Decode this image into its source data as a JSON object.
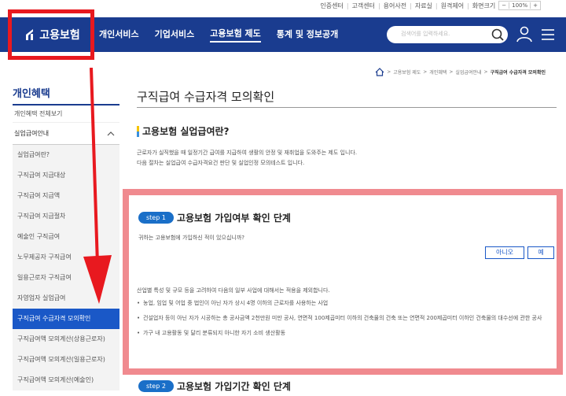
{
  "util": {
    "links": [
      "인증센터",
      "고객센터",
      "용어사전",
      "자료실",
      "원격제어",
      "화면크기"
    ],
    "zoom_out": "−",
    "zoom_value": "100%",
    "zoom_in": "+"
  },
  "header": {
    "logo_text": "고용보험",
    "nav": [
      "개인서비스",
      "기업서비스",
      "고용보험 제도",
      "통계 및 정보공개"
    ],
    "active_nav": "고용보험 제도",
    "search_placeholder": "검색어를 입력하세요."
  },
  "breadcrumb": [
    "고용보험 제도",
    "개인혜택",
    "실업급여안내",
    "구직급여 수급자격 모의확인"
  ],
  "sidebar": {
    "title": "개인혜택",
    "all_link": "개인혜택 전체보기",
    "group": "실업급여안내",
    "items": [
      "실업급여란?",
      "구직급여 지급대상",
      "구직급여 지급액",
      "구직급여 지급절차",
      "예술인 구직급여",
      "노무제공자 구직급여",
      "일용근로자 구직급여",
      "자영업자 실업급여",
      "구직급여 수급자격 모의확인",
      "구직급여액 모의계산(상용근로자)",
      "구직급여액 모의계산(일용근로자)",
      "구직급여액 모의계산(예술인)"
    ],
    "active_item": "구직급여 수급자격 모의확인"
  },
  "main": {
    "page_title": "구직급여 수급자격 모의확인",
    "section_title": "고용보험 실업급여란?",
    "desc_line1": "근로자가 실직했을 때 일정기간 급여를 지급하여 생활의 안정 및 재취업을 도와주는 제도 입니다.",
    "desc_line2": "다음 절차는 실업급여 수급자격요건 판단 및 실업인정 모의테스트 입니다.",
    "step1_badge": "step 1",
    "step1_title": "고용보험 가입여부 확인 단계",
    "question": "귀하는 고용보험에 가입하신 적이 있으십니까?",
    "btn_no": "아니오",
    "btn_yes": "예",
    "note_intro": "산업별 특성 및 규모 등을 고려하여 다음의 일부 사업에 대해서는 적용을 제외합니다.",
    "notes": [
      "농업, 임업 및 어업 중 법인이 아닌 자가 상시 4명 이하의 근로자를 사용하는 사업",
      "건설업자 등이 아닌 자가 시공하는 총 공사금액 2천만원 미만 공사, 연면적 100제곱미터 이하의 건축물의 건축 또는 연면적 200제곱미터 이하인 건축물의 대수선에 관한 공사",
      "가구 내 고용활동 및 달리 분류되지 아니한 자기 소비 생산활동"
    ],
    "step2_badge": "step 2",
    "step2_title": "고용보험 가입기간 확인 단계"
  },
  "colors": {
    "header_blue": "#1a3c8f",
    "active_blue": "#1a58c7",
    "highlight_red": "#e8191f",
    "highlight_pink": "#f08a8f"
  }
}
